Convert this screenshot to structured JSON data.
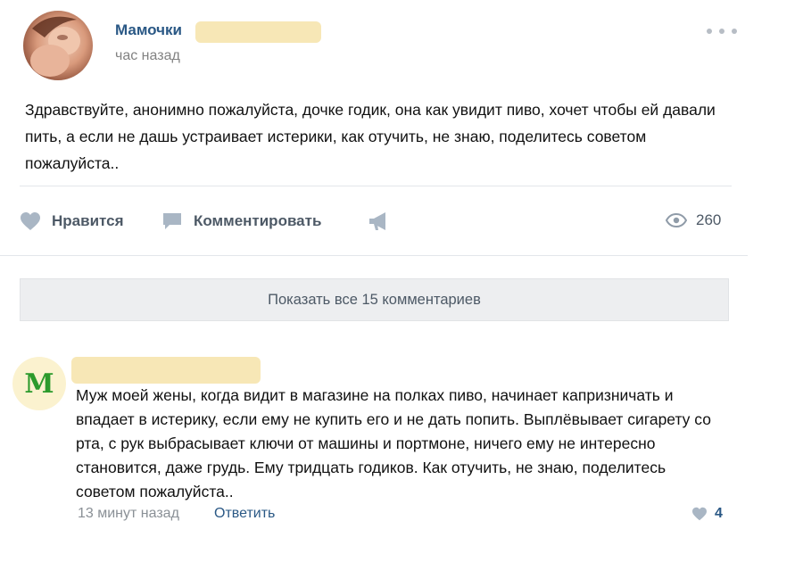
{
  "post": {
    "group_name": "Мамочки",
    "time": "час назад",
    "text": "Здравствуйте, анонимно пожалуйста, дочке годик, она как увидит пиво, хочет чтобы ей давали пить, а если не дашь устраивает истерики, как отучить, не знаю, поделитесь советом пожалуйста..",
    "avatar_icon": "group-avatar-photo",
    "more_icon": "more-dots-icon"
  },
  "actions": {
    "like_label": "Нравится",
    "comment_label": "Комментировать",
    "share_icon": "megaphone-icon",
    "views_count": "260",
    "views_icon": "eye-icon"
  },
  "comments_bar": {
    "show_all_label": "Показать все 15 комментариев"
  },
  "comment": {
    "avatar_letter": "M",
    "text": "Муж моей жены, когда видит в магазине на полках пиво, начинает капризничать и впадает в истерику, если ему не купить его и не дать попить. Выплёвывает сигарету со рта, с рук выбрасывает ключи от машины и портмоне, ничего ему не интересно становится, даже грудь. Ему тридцать годиков. Как отучить, не знаю, поделитесь советом пожалуйста..",
    "time": "13 минут назад",
    "reply_label": "Ответить",
    "likes_count": "4"
  },
  "colors": {
    "link_blue": "#2a5885",
    "muted_gray": "#828282",
    "icon_gray": "#a9b6c4",
    "redaction_yellow": "#f7e7b6",
    "comment_avatar_green": "#2c9a2c"
  }
}
